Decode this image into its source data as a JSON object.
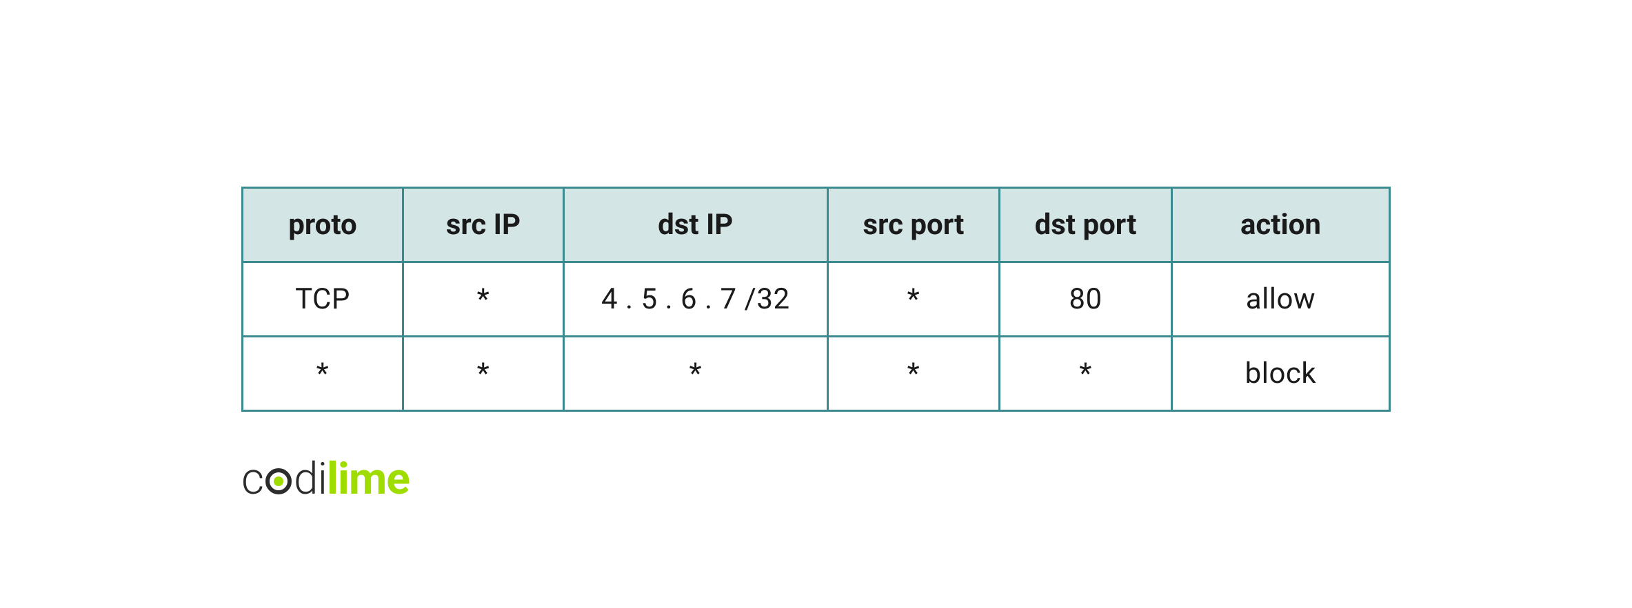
{
  "table": {
    "headers": {
      "proto": "proto",
      "src_ip": "src IP",
      "dst_ip": "dst IP",
      "src_port": "src port",
      "dst_port": "dst port",
      "action": "action"
    },
    "rows": [
      {
        "proto": "TCP",
        "src_ip": "*",
        "dst_ip": "4 . 5 . 6 . 7 /32",
        "src_port": "*",
        "dst_port": "80",
        "action": "allow"
      },
      {
        "proto": "*",
        "src_ip": "*",
        "dst_ip": "*",
        "src_port": "*",
        "dst_port": "*",
        "action": "block"
      }
    ]
  },
  "logo": {
    "part1": "c",
    "part2": "di",
    "part3": "lime"
  }
}
